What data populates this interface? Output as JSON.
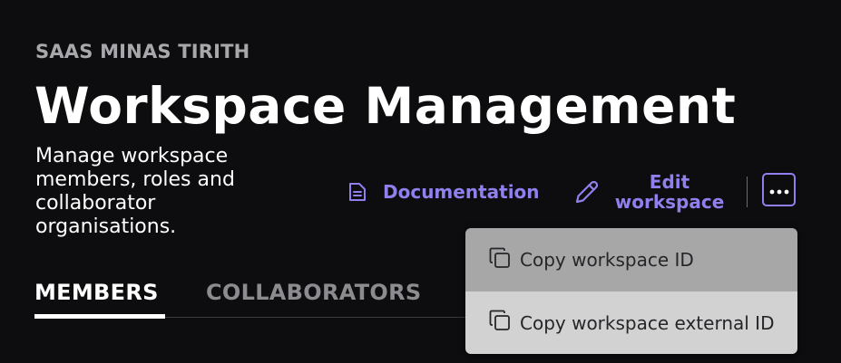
{
  "header": {
    "overline": "SAAS MINAS TIRITH",
    "title": "Workspace Management",
    "description": "Manage workspace members, roles and collaborator organisations."
  },
  "actions": {
    "documentation": {
      "label": "Documentation",
      "icon": "document-icon"
    },
    "edit": {
      "label": "Edit workspace",
      "icon": "pencil-icon"
    },
    "more": {
      "icon": "more-horizontal-icon"
    }
  },
  "tabs": [
    {
      "label": "MEMBERS",
      "active": true
    },
    {
      "label": "COLLABORATORS",
      "active": false
    }
  ],
  "menu": {
    "items": [
      {
        "label": "Copy workspace ID",
        "icon": "copy-icon",
        "hovered": true
      },
      {
        "label": "Copy workspace external ID",
        "icon": "copy-icon",
        "hovered": false
      }
    ]
  },
  "colors": {
    "background": "#0d0c0e",
    "accent": "#8f80ee",
    "muted": "#a8a8ac",
    "menu_hover": "#a7a7a7",
    "menu_bg": "#d2d2d2"
  }
}
